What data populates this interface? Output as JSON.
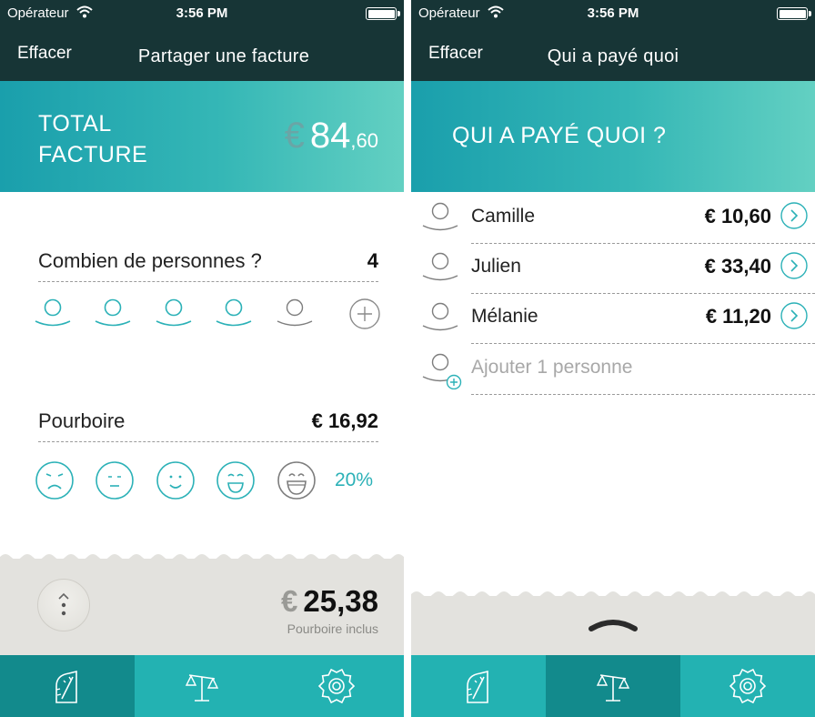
{
  "left": {
    "status": {
      "carrier": "Opérateur",
      "time": "3:56 PM"
    },
    "nav": {
      "clear_label": "Effacer",
      "title": "Partager une facture"
    },
    "banner": {
      "label_line1": "TOTAL",
      "label_line2": "FACTURE",
      "currency": "€",
      "amount_int": "84",
      "amount_dec": ",60"
    },
    "people": {
      "label": "Combien de personnes ?",
      "count": "4"
    },
    "tip": {
      "label": "Pourboire",
      "amount": "€ 16,92",
      "percent": "20%"
    },
    "footer": {
      "currency": "€",
      "amount": "25,38",
      "note": "Pourboire inclus"
    }
  },
  "right": {
    "status": {
      "carrier": "Opérateur",
      "time": "3:56 PM"
    },
    "nav": {
      "clear_label": "Effacer",
      "title": "Qui a payé quoi"
    },
    "banner": {
      "title": "QUI A PAYÉ QUOI ?"
    },
    "payers": [
      {
        "name": "Camille",
        "amount": "€ 10,60"
      },
      {
        "name": "Julien",
        "amount": "€ 33,40"
      },
      {
        "name": "Mélanie",
        "amount": "€ 11,20"
      }
    ],
    "add_placeholder": "Ajouter 1 personne"
  },
  "colors": {
    "accent": "#23b2b2",
    "accent_dark": "#128a8c",
    "nav_bg": "#173536",
    "footer_bg": "#e3e2de"
  },
  "tabs": [
    "calculator-icon",
    "scale-icon",
    "gear-icon"
  ],
  "selected_people": 4,
  "selected_tip_level": 5
}
